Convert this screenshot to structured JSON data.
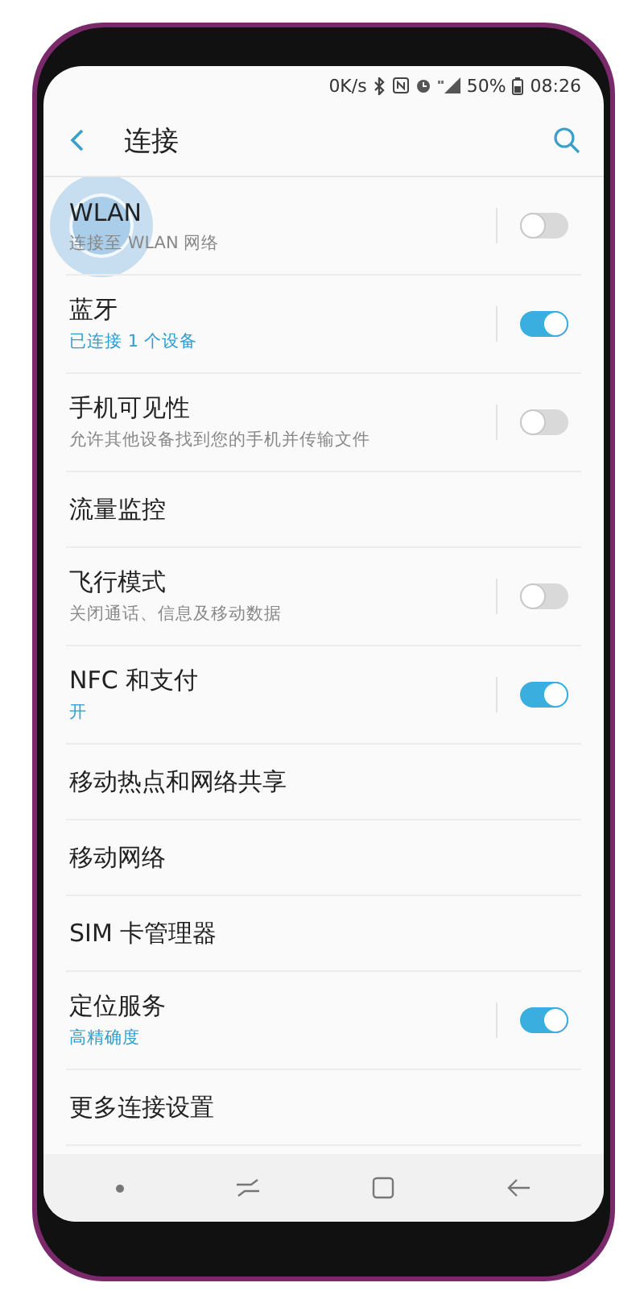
{
  "status_bar": {
    "speed": "0K/s",
    "battery": "50%",
    "time": "08:26"
  },
  "header": {
    "title": "连接"
  },
  "items": [
    {
      "title": "WLAN",
      "subtitle": "连接至 WLAN 网络",
      "subtitle_highlighted": false,
      "kind": "switch",
      "on": false,
      "touched": true
    },
    {
      "title": "蓝牙",
      "subtitle": "已连接 1 个设备",
      "subtitle_highlighted": true,
      "kind": "switch",
      "on": true,
      "touched": false
    },
    {
      "title": "手机可见性",
      "subtitle": "允许其他设备找到您的手机并传输文件",
      "subtitle_highlighted": false,
      "kind": "switch",
      "on": false,
      "touched": false
    },
    {
      "title": "流量监控",
      "kind": "plain",
      "touched": false
    },
    {
      "title": "飞行模式",
      "subtitle": "关闭通话、信息及移动数据",
      "subtitle_highlighted": false,
      "kind": "switch",
      "on": false,
      "touched": false
    },
    {
      "title": "NFC 和支付",
      "subtitle": "开",
      "subtitle_highlighted": true,
      "kind": "switch",
      "on": true,
      "touched": false
    },
    {
      "title": "移动热点和网络共享",
      "kind": "plain",
      "touched": false
    },
    {
      "title": "移动网络",
      "kind": "plain",
      "touched": false
    },
    {
      "title": "SIM 卡管理器",
      "kind": "plain",
      "touched": false
    },
    {
      "title": "定位服务",
      "subtitle": "高精确度",
      "subtitle_highlighted": true,
      "kind": "switch",
      "on": true,
      "touched": false
    },
    {
      "title": "更多连接设置",
      "kind": "plain",
      "touched": false
    }
  ]
}
